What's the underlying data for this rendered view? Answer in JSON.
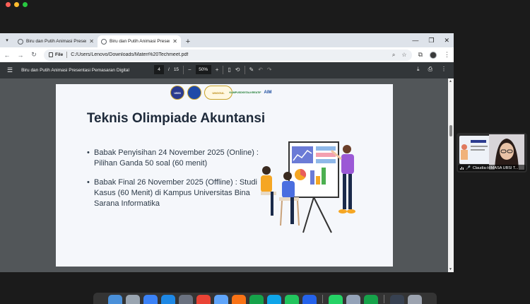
{
  "browser": {
    "tabs": [
      {
        "label": "Biru dan Putih Animasi Presentasi Pemasaran Digital",
        "active": false
      },
      {
        "label": "Biru dan Putih Animasi Presentasi Pemasaran Digital",
        "active": true
      }
    ],
    "address": {
      "scheme_chip": "File",
      "url": "C:/Users/Lenovo/Downloads/Materi%20Techmeet.pdf"
    }
  },
  "pdf_viewer": {
    "doc_title": "Biru dan Putih Animasi Presentasi Pemasaran Digital",
    "current_page": "4",
    "page_sep": "/",
    "total_pages": "15",
    "zoom": "50%"
  },
  "slide": {
    "logo_text": {
      "rank": "UNGGUL",
      "kd_line1": "KAMPUS",
      "kd_line2": "DIGITAL",
      "kd_line3": "KREATIF",
      "ai": "AIM"
    },
    "title": "Teknis Olimpiade Akuntansi",
    "bullets": [
      "Babak Penyisihan 24 November 2025 (Online) : Pilihan Ganda 50 soal (60 menit)",
      "Babak Final 26 November 2025 (Offline) : Studi Kasus (60 Menit) di Kampus Universitas Bina Sarana Informatika"
    ]
  },
  "video_tile": {
    "participant_name": "Claudia-HIMASA UBSI T..."
  },
  "colors": {
    "pdf_toolbar": "#323639",
    "pdf_background": "#525659",
    "slide_title": "#1e2a3a",
    "dock_bg": "#464646"
  }
}
